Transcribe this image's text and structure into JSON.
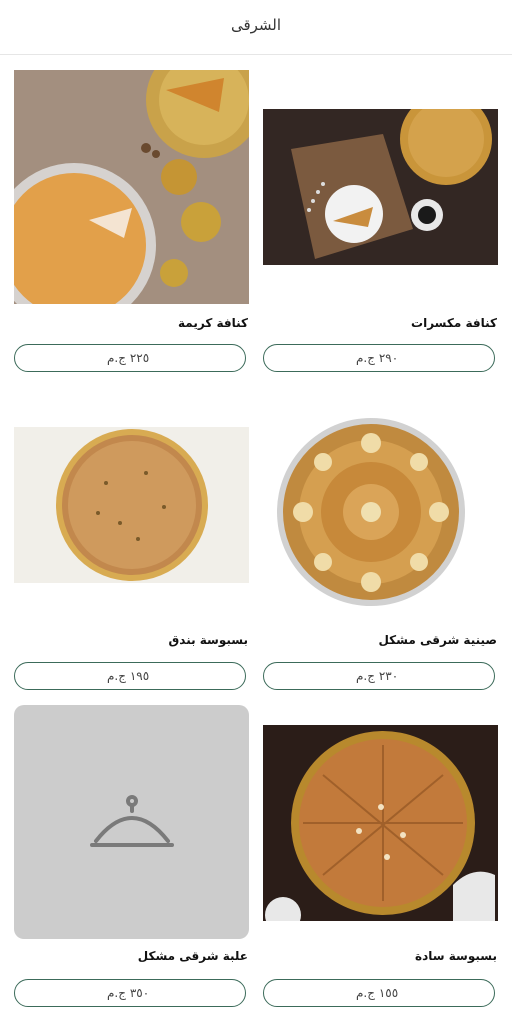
{
  "header": {
    "title": "الشرقى"
  },
  "products": [
    {
      "name": "كنافة مكسرات",
      "price": "٢٩٠ ج.م",
      "image": "kunafa-nuts-photo"
    },
    {
      "name": "كنافة كريمة",
      "price": "٢٢٥ ج.م",
      "image": "kunafa-cream-photo"
    },
    {
      "name": "صينية شرقى مشكل",
      "price": "٢٣٠ ج.م",
      "image": "mixed-oriental-tray-photo"
    },
    {
      "name": "بسبوسة بندق",
      "price": "١٩٥ ج.م",
      "image": "basbousa-hazelnut-photo"
    },
    {
      "name": "بسبوسة سادة",
      "price": "١٥٥ ج.م",
      "image": "plain-basbousa-photo"
    },
    {
      "name": "علبة شرقى مشكل",
      "price": "٣٥٠ ج.م",
      "image": "food-cloche-icon"
    }
  ]
}
